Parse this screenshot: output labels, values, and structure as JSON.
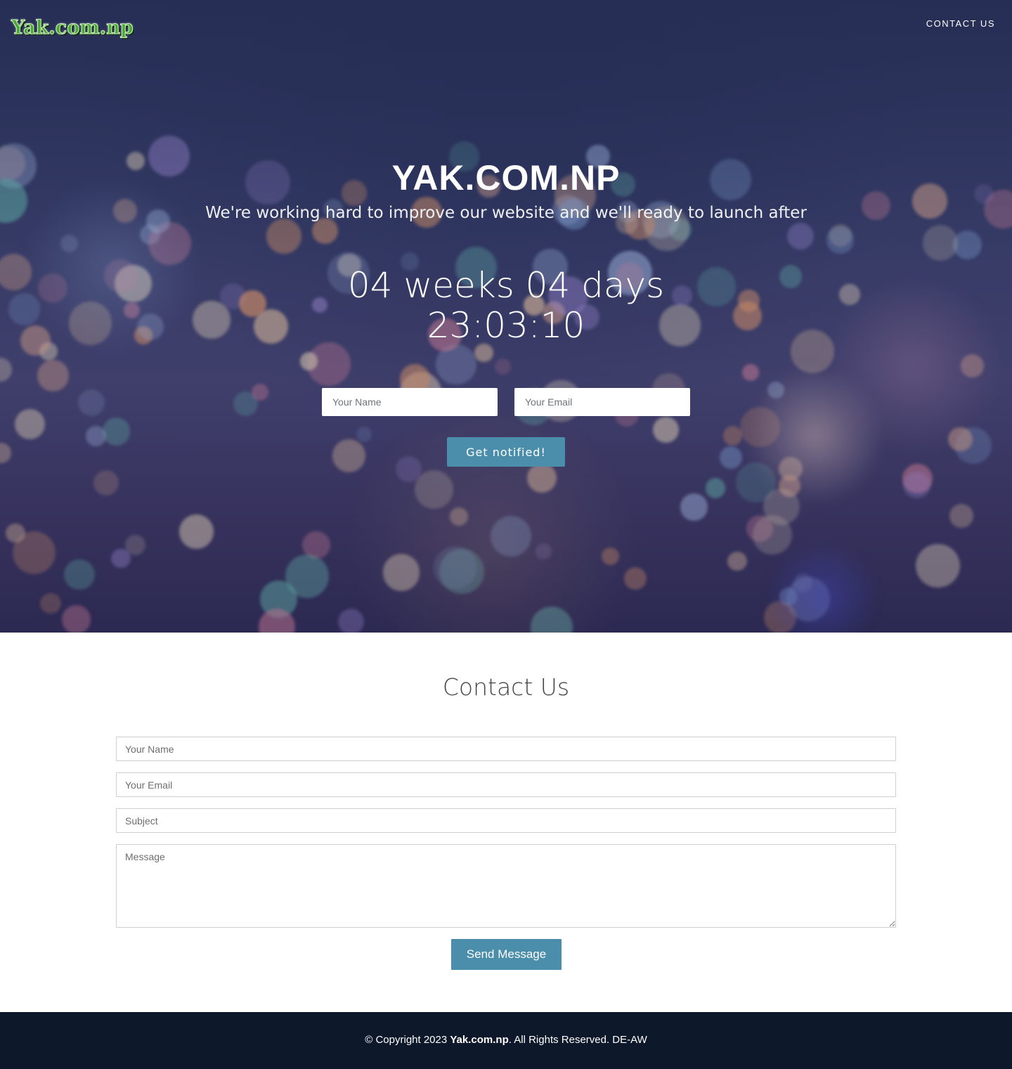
{
  "header": {
    "logo_text": "Yak.com.np",
    "nav_contact": "CONTACT US"
  },
  "hero": {
    "title": "YAK.COM.NP",
    "tagline": "We're working hard to improve our website and we'll ready to launch after",
    "countdown_line1": "04 weeks 04 days",
    "countdown_line2": "23:03:10",
    "name_placeholder": "Your Name",
    "email_placeholder": "Your Email",
    "notify_label": "Get notified!"
  },
  "contact": {
    "title": "Contact Us",
    "name_placeholder": "Your Name",
    "email_placeholder": "Your Email",
    "subject_placeholder": "Subject",
    "message_placeholder": "Message",
    "send_label": "Send Message"
  },
  "footer": {
    "prefix": "© Copyright 2023 ",
    "brand": "Yak.com.np",
    "suffix": ". All Rights Reserved. DE-AW"
  },
  "colors": {
    "accent": "#4b8eac",
    "footer_bg": "#0e182b",
    "hero_bg": "#2f3560"
  }
}
